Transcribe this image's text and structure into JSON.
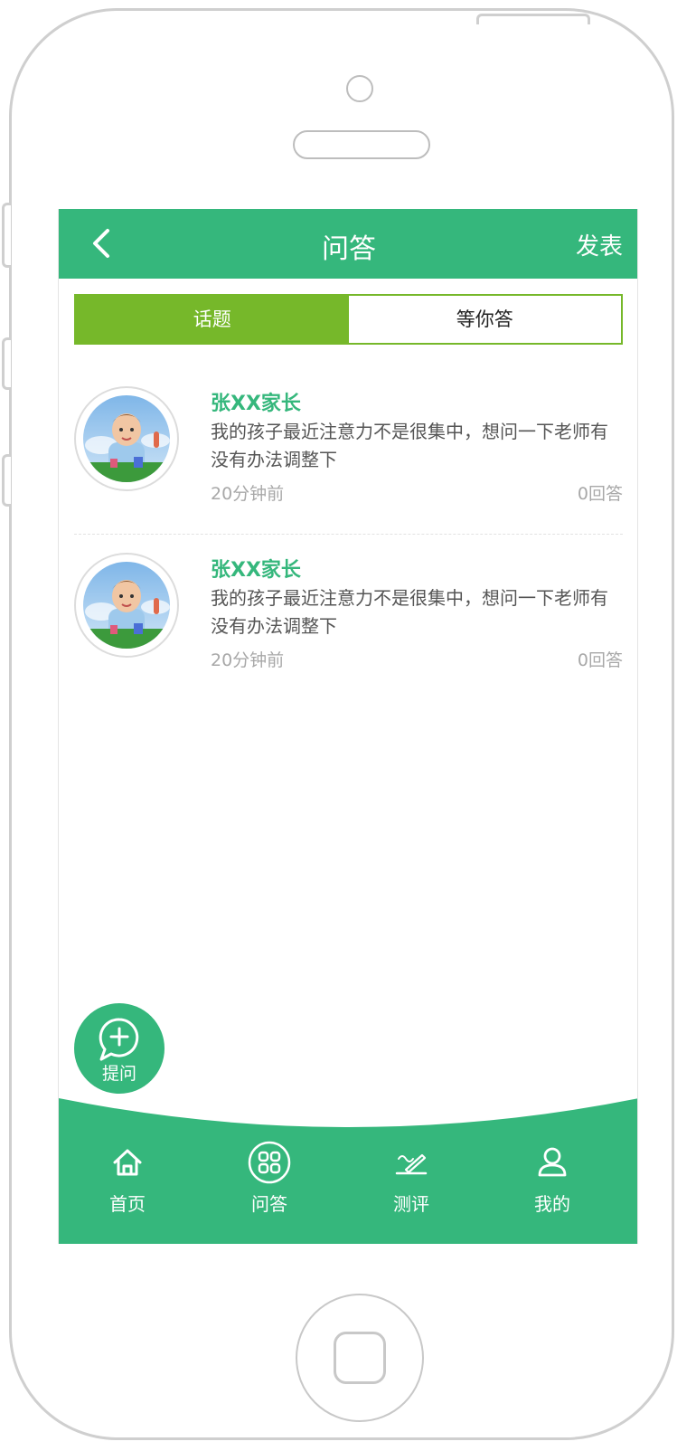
{
  "header": {
    "title": "问答",
    "action": "发表",
    "back_icon": "chevron-left-icon"
  },
  "tabs": [
    {
      "label": "话题",
      "active": true
    },
    {
      "label": "等你答",
      "active": false
    }
  ],
  "questions": [
    {
      "author": "张XX家长",
      "text": "我的孩子最近注意力不是很集中，想问一下老师有没有办法调整下",
      "time": "20分钟前",
      "answers": "0回答"
    },
    {
      "author": "张XX家长",
      "text": "我的孩子最近注意力不是很集中，想问一下老师有没有办法调整下",
      "time": "20分钟前",
      "answers": "0回答"
    }
  ],
  "fab": {
    "label": "提问",
    "icon": "plus-chat-icon"
  },
  "tabbar": [
    {
      "label": "首页",
      "icon": "home-icon"
    },
    {
      "label": "问答",
      "icon": "grid-icon"
    },
    {
      "label": "测评",
      "icon": "pen-icon"
    },
    {
      "label": "我的",
      "icon": "user-icon"
    }
  ],
  "colors": {
    "primary": "#35b77c",
    "tab_active": "#76b82a"
  }
}
